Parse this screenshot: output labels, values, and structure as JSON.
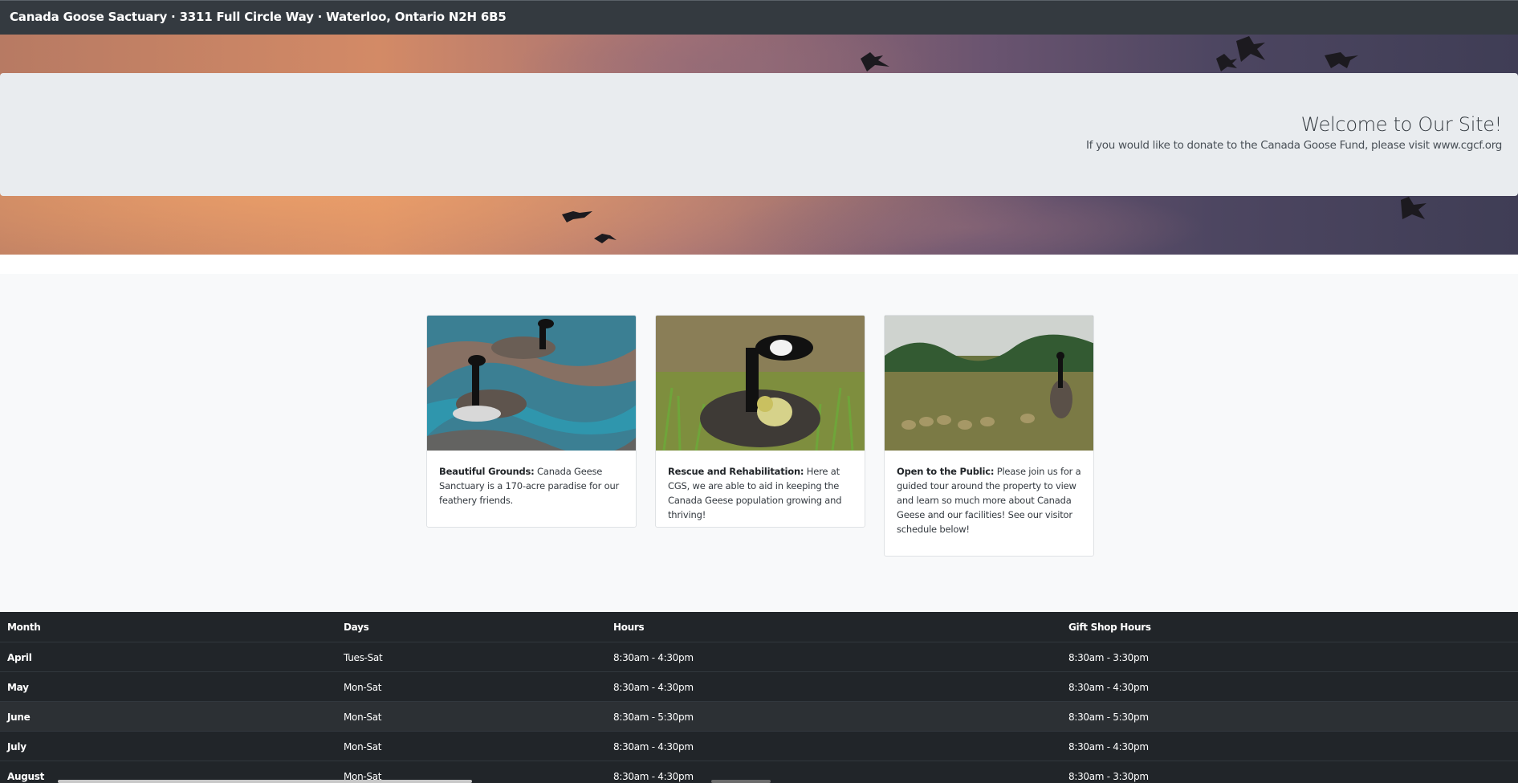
{
  "navbar": {
    "brand": "Canada Goose Sactuary · 3311 Full Circle Way · Waterloo, Ontario N2H 6B5"
  },
  "jumbotron": {
    "title": "Welcome to Our Site!",
    "subtitle": "If you would like to donate to the Canada Goose Fund, please visit www.cgcf.org"
  },
  "cards": [
    {
      "image_icon": "geese-swimming-photo",
      "bold": "Beautiful Grounds:",
      "text": " Canada Geese Sanctuary is a 170-acre paradise for our feathery friends."
    },
    {
      "image_icon": "goose-with-gosling-photo",
      "bold": "Rescue and Rehabilitation:",
      "text": " Here at CGS, we are able to aid in keeping the Canada Geese population growing and thriving!"
    },
    {
      "image_icon": "goose-family-field-photo",
      "bold": "Open to the Public:",
      "text": " Please join us for a guided tour around the property to view and learn so much more about Canada Geese and our facilities! See our visitor schedule below!"
    }
  ],
  "schedule": {
    "headers": [
      "Month",
      "Days",
      "Hours",
      "Gift Shop Hours"
    ],
    "rows": [
      [
        "April",
        "Tues-Sat",
        "8:30am - 4:30pm",
        "8:30am - 3:30pm"
      ],
      [
        "May",
        "Mon-Sat",
        "8:30am - 4:30pm",
        "8:30am - 4:30pm"
      ],
      [
        "June",
        "Mon-Sat",
        "8:30am - 5:30pm",
        "8:30am - 5:30pm"
      ],
      [
        "July",
        "Mon-Sat",
        "8:30am - 4:30pm",
        "8:30am - 4:30pm"
      ],
      [
        "August",
        "Mon-Sat",
        "8:30am - 4:30pm",
        "8:30am - 3:30pm"
      ]
    ]
  },
  "colors": {
    "navbar_bg": "#343a40",
    "jumbotron_bg": "#e9ecef",
    "table_bg": "#212529",
    "table_row_alt": "#2c3034"
  }
}
